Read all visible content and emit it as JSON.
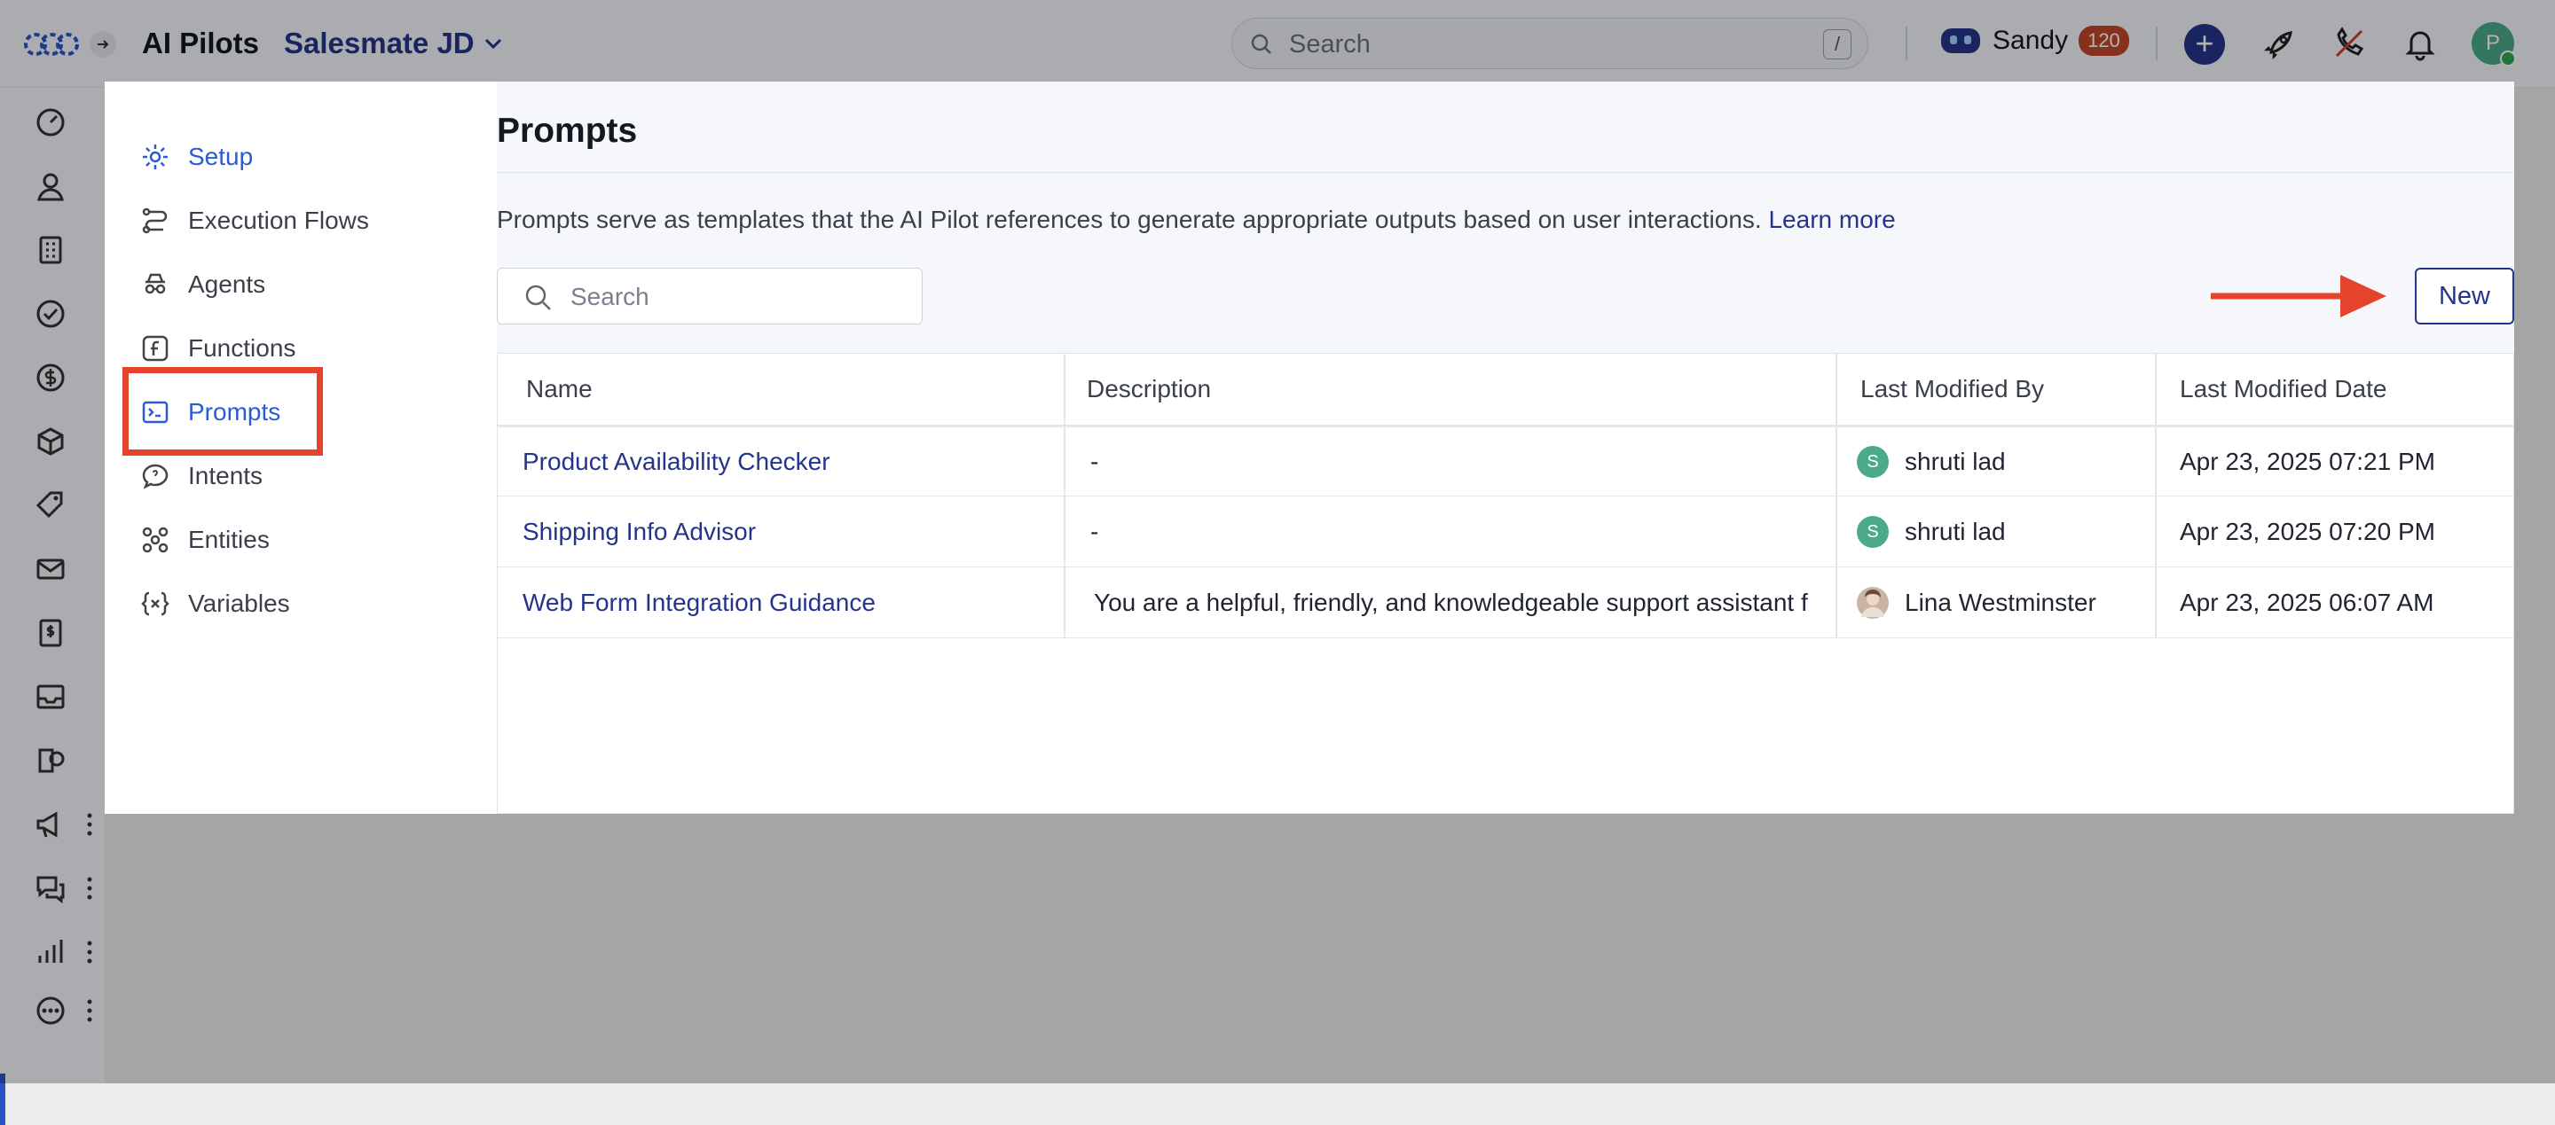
{
  "topbar": {
    "app_title": "AI Pilots",
    "workspace": "Salesmate JD",
    "search_placeholder": "Search",
    "search_shortcut": "/",
    "user_name": "Sandy",
    "user_badge": "120",
    "plus_label": "+",
    "avatar_initial": "P"
  },
  "subnav": {
    "items": [
      {
        "label": "Setup",
        "icon": "gear-icon"
      },
      {
        "label": "Execution Flows",
        "icon": "flow-icon"
      },
      {
        "label": "Agents",
        "icon": "agent-icon"
      },
      {
        "label": "Functions",
        "icon": "function-icon"
      },
      {
        "label": "Prompts",
        "icon": "terminal-icon"
      },
      {
        "label": "Intents",
        "icon": "chat-bubble-icon"
      },
      {
        "label": "Entities",
        "icon": "entities-icon"
      },
      {
        "label": "Variables",
        "icon": "variables-icon"
      }
    ]
  },
  "main": {
    "title": "Prompts",
    "description": "Prompts serve as templates that the AI Pilot references to generate appropriate outputs based on user interactions.",
    "learn_more": "Learn more",
    "search_placeholder": "Search",
    "new_button": "New",
    "table": {
      "columns": [
        "Name",
        "Description",
        "Last Modified By",
        "Last Modified Date"
      ],
      "rows": [
        {
          "name": "Product Availability Checker",
          "description": "-",
          "modified_by": "shruti lad",
          "modified_by_initial": "S",
          "modified_date": "Apr 23, 2025 07:21 PM"
        },
        {
          "name": "Shipping Info Advisor",
          "description": "-",
          "modified_by": "shruti lad",
          "modified_by_initial": "S",
          "modified_date": "Apr 23, 2025 07:20 PM"
        },
        {
          "name": "Web Form Integration Guidance",
          "description": "You are a helpful, friendly, and knowledgeable support assistant f",
          "modified_by": "Lina Westminster",
          "modified_by_initial": "",
          "modified_date": "Apr 23, 2025 06:07 AM"
        }
      ]
    }
  },
  "colors": {
    "accent": "#2a5bd7",
    "brand": "#24348a",
    "highlight": "#e5432b",
    "badge": "#c0462a"
  }
}
